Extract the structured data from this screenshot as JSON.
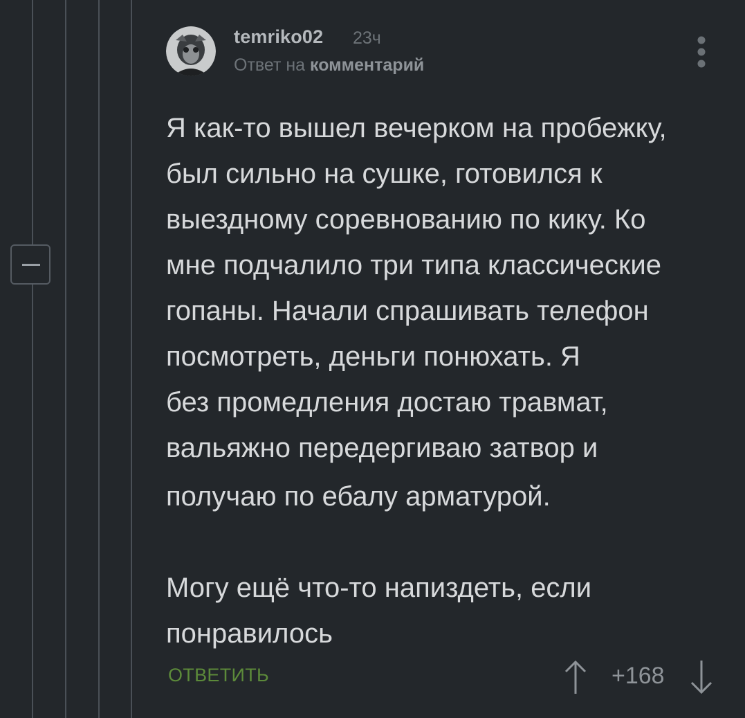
{
  "comment": {
    "author": "temriko02",
    "time": "23ч",
    "reply_prefix": "Ответ на",
    "reply_target": "комментарий",
    "paragraphs": [
      [
        "Я как-то вышел вечерком на пробежку,",
        "был сильно на сушке, готовился к",
        "выездному соревнованию по кику. Ко",
        "мне подчалило три типа классические",
        "гопаны. Начали спрашивать телефон",
        "посмотреть, деньги понюхать. Я",
        "без промедления достаю травмат,",
        "вальяжно передергиваю затвор и",
        "получаю по ебалу арматурой."
      ],
      [
        "Могу ещё что-то напиздеть, если",
        "понравилось"
      ]
    ],
    "reply_label": "ОТВЕТИТЬ",
    "rating": "+168"
  },
  "icons": {
    "collapse": "minus-icon",
    "more": "more-vertical-icon",
    "vote_up": "arrow-up-icon",
    "vote_down": "arrow-down-icon"
  },
  "colors": {
    "background": "#23272b",
    "reply_accent": "#5c8a3a",
    "text": "#d7d9db"
  }
}
